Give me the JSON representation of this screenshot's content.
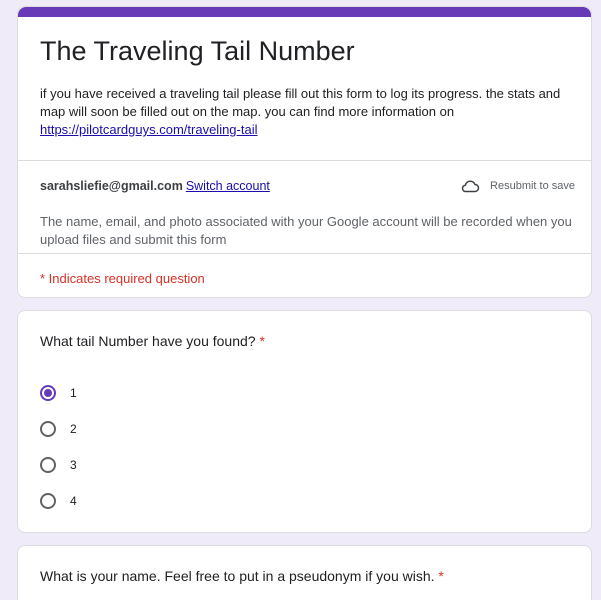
{
  "form": {
    "title": "The Traveling Tail Number",
    "description_text": "if you have received a traveling tail please fill out this form to log its progress. the stats and map will soon be filled out on the map. you can find more information on ",
    "description_link": "https://pilotcardguys.com/traveling-tail",
    "accent_color": "#673ab7"
  },
  "account": {
    "email": "sarahsliefie@gmail.com",
    "switch_label": "Switch account",
    "save_status": "Resubmit to save",
    "save_icon": "cloud-icon",
    "notice": "The name, email, and photo associated with your Google account will be recorded when you upload files and submit this form"
  },
  "required_note": "* Indicates required question",
  "questions": [
    {
      "title": "What tail Number have you found?",
      "required_mark": "*",
      "options": [
        {
          "label": "1",
          "selected": true
        },
        {
          "label": "2",
          "selected": false
        },
        {
          "label": "3",
          "selected": false
        },
        {
          "label": "4",
          "selected": false
        }
      ]
    },
    {
      "title": "What is your name. Feel free to put in a pseudonym if you wish.",
      "required_mark": "*"
    }
  ]
}
